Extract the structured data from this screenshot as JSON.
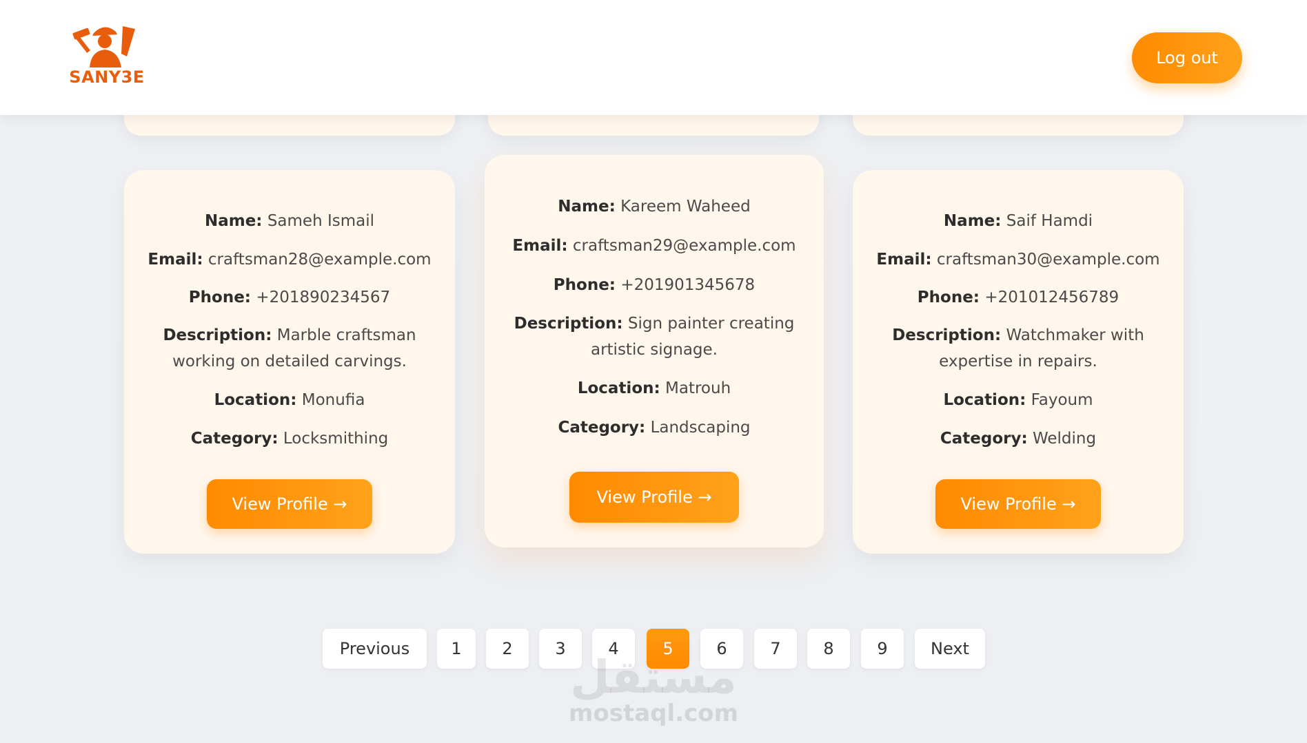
{
  "brand": {
    "name": "SANY3E",
    "logo_icon": "craftsman-hammer-icon",
    "color": "#e85d0c"
  },
  "header": {
    "logout_label": "Log out"
  },
  "accent_color": "#ff8a00",
  "cards": [
    {
      "name_label": "Name:",
      "name": "Sameh Ismail",
      "email_label": "Email:",
      "email": "craftsman28@example.com",
      "phone_label": "Phone:",
      "phone": "+201890234567",
      "description_label": "Description:",
      "description_line1": "Marble craftsman",
      "description_line2": "working on detailed carvings.",
      "location_label": "Location:",
      "location": "Monufia",
      "category_label": "Category:",
      "category": "Locksmithing",
      "button_label": "View Profile →"
    },
    {
      "name_label": "Name:",
      "name": "Kareem Waheed",
      "email_label": "Email:",
      "email": "craftsman29@example.com",
      "phone_label": "Phone:",
      "phone": "+201901345678",
      "description_label": "Description:",
      "description_line1": "Sign painter creating",
      "description_line2": "artistic signage.",
      "location_label": "Location:",
      "location": "Matrouh",
      "category_label": "Category:",
      "category": "Landscaping",
      "button_label": "View Profile →"
    },
    {
      "name_label": "Name:",
      "name": "Saif Hamdi",
      "email_label": "Email:",
      "email": "craftsman30@example.com",
      "phone_label": "Phone:",
      "phone": "+201012456789",
      "description_label": "Description:",
      "description_line1": "Watchmaker with",
      "description_line2": "expertise in repairs.",
      "location_label": "Location:",
      "location": "Fayoum",
      "category_label": "Category:",
      "category": "Welding",
      "button_label": "View Profile →"
    }
  ],
  "pagination": {
    "previous_label": "Previous",
    "next_label": "Next",
    "pages": [
      "1",
      "2",
      "3",
      "4",
      "5",
      "6",
      "7",
      "8",
      "9"
    ],
    "current_page": "5"
  },
  "watermark": {
    "arabic": "مستقل",
    "latin": "mostaql.com"
  }
}
